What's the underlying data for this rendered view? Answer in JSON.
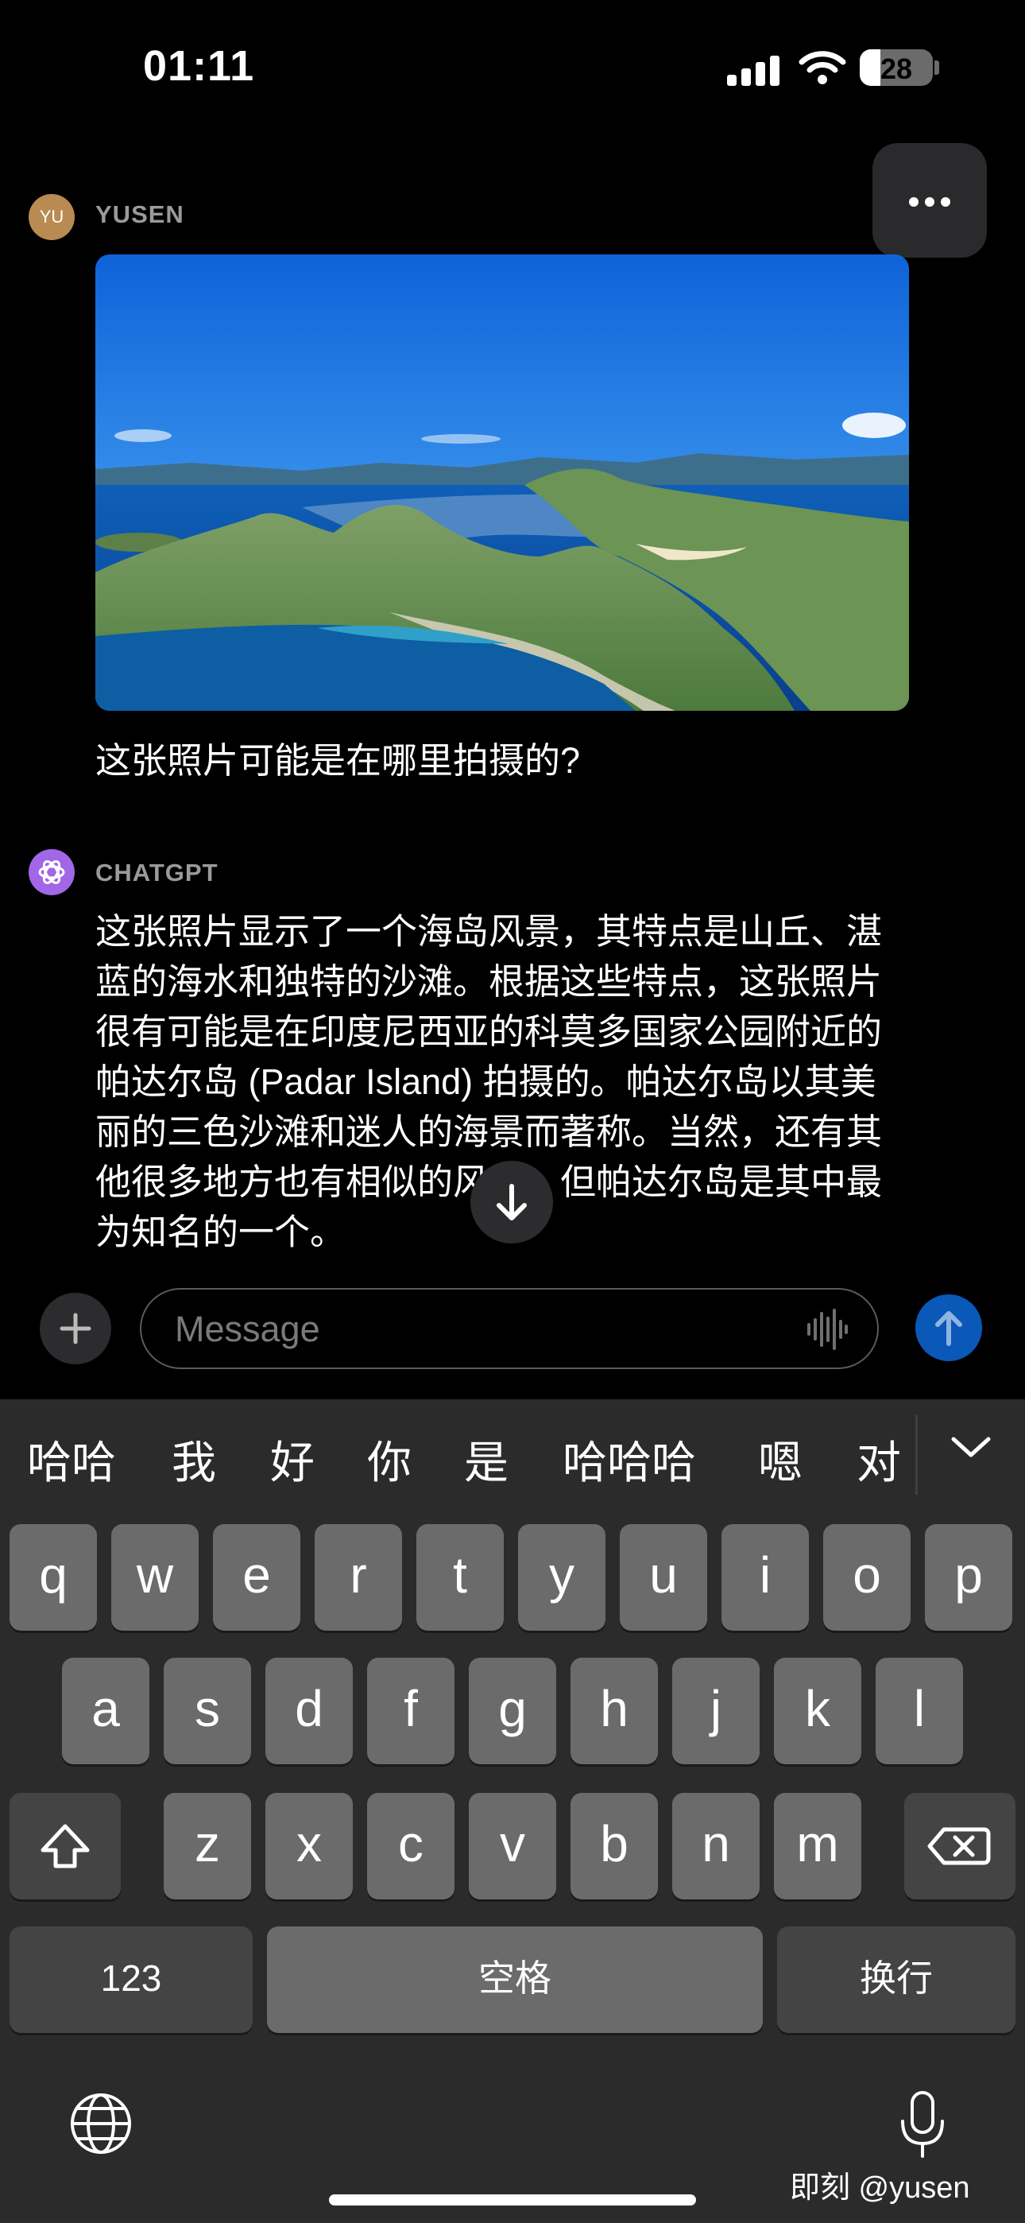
{
  "status_bar": {
    "time": "01:11",
    "battery": "28",
    "battery_level": 0.28
  },
  "user": {
    "avatar_initials": "YU",
    "name": "YUSEN",
    "message": "这张照片可能是在哪里拍摄的?"
  },
  "assistant": {
    "name": "CHATGPT",
    "lines": [
      "这张照片显示了一个海岛风景，其特点是山丘、湛",
      "蓝的海水和独特的沙滩。根据这些特点，这张照片",
      "很有可能是在印度尼西亚的科莫多国家公园附近的",
      "帕达尔岛 (Padar Island) 拍摄的。帕达尔岛以其美",
      "丽的三色沙滩和迷人的海景而著称。当然，还有其",
      "他很多地方也有相似的风景，但帕达尔岛是其中最",
      "为知名的一个。"
    ]
  },
  "composer": {
    "placeholder": "Message"
  },
  "keyboard": {
    "candidates": [
      "哈哈",
      "我",
      "好",
      "你",
      "是",
      "哈哈哈",
      "嗯",
      "对"
    ],
    "row1": [
      "q",
      "w",
      "e",
      "r",
      "t",
      "y",
      "u",
      "i",
      "o",
      "p"
    ],
    "row2": [
      "a",
      "s",
      "d",
      "f",
      "g",
      "h",
      "j",
      "k",
      "l"
    ],
    "row3": [
      "z",
      "x",
      "c",
      "v",
      "b",
      "n",
      "m"
    ],
    "numbers_label": "123",
    "space_label": "空格",
    "return_label": "换行"
  },
  "watermark": "即刻 @yusen",
  "icons": [
    "signal-icon",
    "wifi-icon",
    "battery-icon",
    "more-icon",
    "openai-logo-icon",
    "arrow-down-icon",
    "plus-icon",
    "waveform-icon",
    "arrow-up-icon",
    "chevron-down-icon",
    "shift-icon",
    "delete-icon",
    "globe-icon",
    "mic-icon"
  ]
}
